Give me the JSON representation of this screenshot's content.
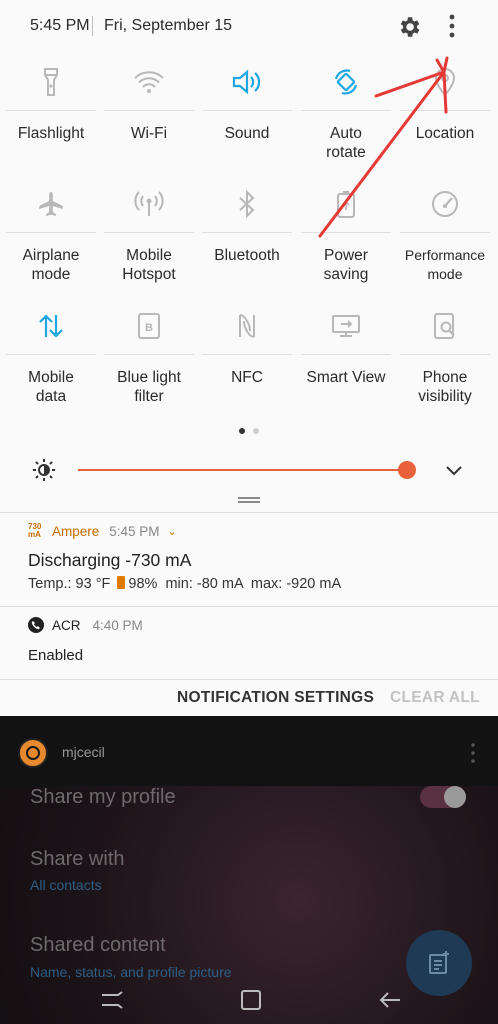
{
  "status": {
    "time": "5:45 PM",
    "date": "Fri, September 15"
  },
  "quick_settings": {
    "tiles": [
      {
        "label": "Flashlight",
        "icon": "flashlight-icon",
        "active": false
      },
      {
        "label": "Wi-Fi",
        "icon": "wifi-icon",
        "active": false
      },
      {
        "label": "Sound",
        "icon": "sound-icon",
        "active": true
      },
      {
        "label": "Auto\nrotate",
        "icon": "auto-rotate-icon",
        "active": true
      },
      {
        "label": "Location",
        "icon": "location-icon",
        "active": false
      },
      {
        "label": "Airplane\nmode",
        "icon": "airplane-icon",
        "active": false
      },
      {
        "label": "Mobile\nHotspot",
        "icon": "hotspot-icon",
        "active": false
      },
      {
        "label": "Bluetooth",
        "icon": "bluetooth-icon",
        "active": false
      },
      {
        "label": "Power\nsaving",
        "icon": "power-saving-icon",
        "active": false
      },
      {
        "label": "Performance\nmode",
        "icon": "performance-mode-icon",
        "active": false
      },
      {
        "label": "Mobile\ndata",
        "icon": "mobile-data-icon",
        "active": true
      },
      {
        "label": "Blue light\nfilter",
        "icon": "blue-light-filter-icon",
        "active": false
      },
      {
        "label": "NFC",
        "icon": "nfc-icon",
        "active": false
      },
      {
        "label": "Smart View",
        "icon": "smart-view-icon",
        "active": false
      },
      {
        "label": "Phone\nvisibility",
        "icon": "phone-visibility-icon",
        "active": false
      }
    ],
    "page_count": 2,
    "active_page": 1
  },
  "brightness": {
    "level": 0.98
  },
  "notifications": [
    {
      "app_badge": "730\nmA",
      "app": "Ampere",
      "time": "5:45 PM",
      "title": "Discharging -730 mA",
      "detail_temp": "Temp.: 93 °F",
      "detail_rest": "98%  min: -80 mA  max: -920 mA"
    },
    {
      "app": "ACR",
      "time": "4:40 PM",
      "body": "Enabled"
    }
  ],
  "actions": {
    "settings": "NOTIFICATION SETTINGS",
    "clear": "CLEAR ALL"
  },
  "background_app": {
    "username": "mjcecil",
    "share_profile": "Share my profile",
    "share_with": "Share with",
    "share_with_value": "All contacts",
    "shared_content": "Shared content",
    "shared_content_value": "Name, status, and profile picture"
  },
  "colors": {
    "accent_blue": "#1ea7e1",
    "accent_orange": "#e8613a",
    "annotation_red": "#e53935"
  }
}
